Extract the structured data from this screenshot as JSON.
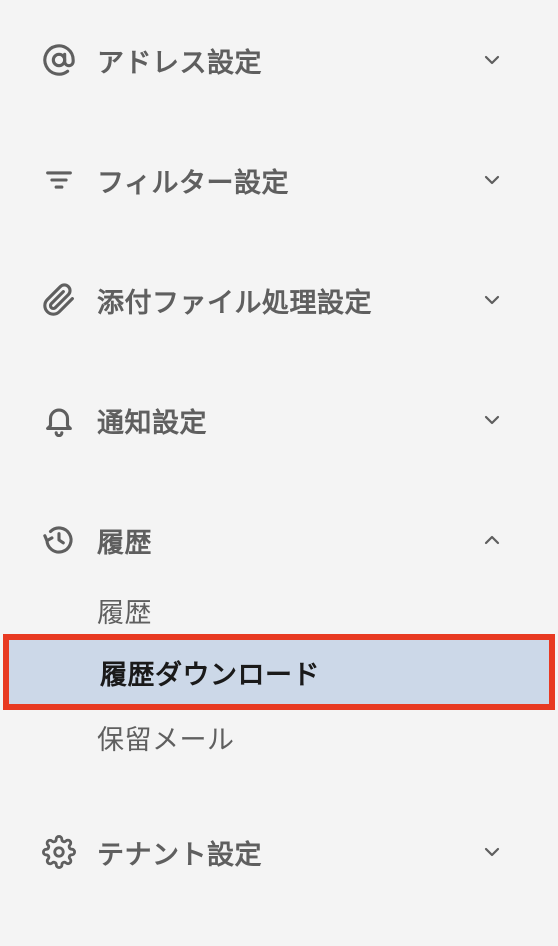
{
  "sidebar": {
    "sections": [
      {
        "label": "アドレス設定",
        "icon": "at-sign-icon",
        "expanded": false
      },
      {
        "label": "フィルター設定",
        "icon": "filter-icon",
        "expanded": false
      },
      {
        "label": "添付ファイル処理設定",
        "icon": "paperclip-icon",
        "expanded": false
      },
      {
        "label": "通知設定",
        "icon": "bell-icon",
        "expanded": false
      },
      {
        "label": "履歴",
        "icon": "history-icon",
        "expanded": true,
        "items": [
          {
            "label": "履歴",
            "active": false
          },
          {
            "label": "履歴ダウンロード",
            "active": true
          },
          {
            "label": "保留メール",
            "active": false
          }
        ]
      },
      {
        "label": "テナント設定",
        "icon": "gear-icon",
        "expanded": false
      }
    ]
  },
  "colors": {
    "background": "#f4f4f4",
    "text": "#5f5f5f",
    "active_text": "#1a1a1a",
    "active_background": "#ccd8e8",
    "highlight_border": "#e83a22"
  }
}
